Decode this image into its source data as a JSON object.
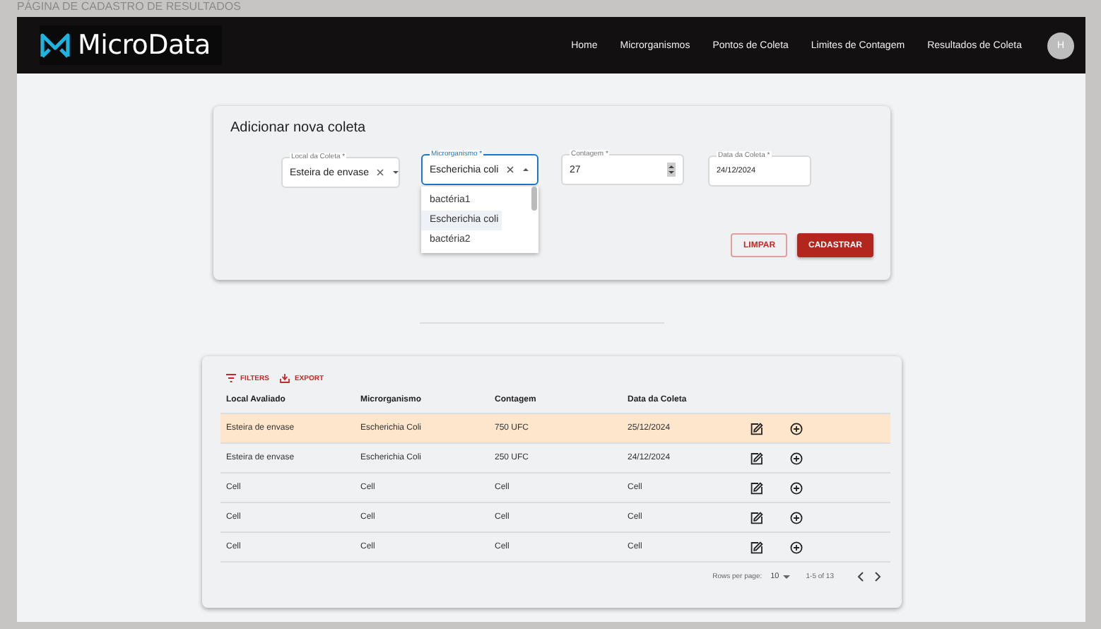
{
  "page_title": "PÁGINA DE CADASTRO DE RESULTADOS",
  "navbar": {
    "brand": "MicroData",
    "links": [
      "Home",
      "Microrganismos",
      "Pontos de Coleta",
      "Limites de Contagem",
      "Resultados de Coleta"
    ],
    "avatar": "H"
  },
  "form": {
    "title": "Adicionar nova coleta",
    "fields": [
      {
        "kind": "select",
        "label": "Local da Coleta *",
        "value": "Esteira de envase",
        "focused": false,
        "expanded": false
      },
      {
        "kind": "select",
        "label": "Microrganismo *",
        "value": "Escherichia coli",
        "focused": true,
        "expanded": true,
        "options": [
          {
            "label": "bactéria1",
            "selected": false
          },
          {
            "label": "Escherichia coli",
            "selected": true
          },
          {
            "label": "bactéria2",
            "selected": false
          }
        ]
      },
      {
        "kind": "number",
        "label": "Contagem *",
        "value": "27",
        "focused": false
      },
      {
        "kind": "date",
        "label": "Data da Coleta *",
        "value": "24/12/2024",
        "focused": false
      }
    ],
    "buttons": [
      {
        "label": "LIMPAR",
        "kind": "outlined"
      },
      {
        "label": "CADASTRAR",
        "kind": "contained"
      }
    ]
  },
  "table": {
    "toolbar": [
      {
        "label": "FILTERS",
        "kind": "filter"
      },
      {
        "label": "EXPORT",
        "kind": "export"
      }
    ],
    "columns": [
      "Local Avaliado",
      "Microrganismo",
      "Contagem",
      "Data da Coleta"
    ],
    "rows": [
      {
        "cells": [
          "Esteira de envase",
          "Escherichia Coli",
          "750 UFC",
          "25/12/2024"
        ],
        "selected": true
      },
      {
        "cells": [
          "Esteira de envase",
          "Escherichia Coli",
          "250 UFC",
          "24/12/2024"
        ],
        "selected": false
      },
      {
        "cells": [
          "Cell",
          "Cell",
          "Cell",
          "Cell"
        ],
        "selected": false
      },
      {
        "cells": [
          "Cell",
          "Cell",
          "Cell",
          "Cell"
        ],
        "selected": false
      },
      {
        "cells": [
          "Cell",
          "Cell",
          "Cell",
          "Cell"
        ],
        "selected": false
      }
    ],
    "pagination": {
      "rows_per_page_label": "Rows per page:",
      "rows_per_page": "10",
      "range": "1-5 of 13"
    }
  }
}
